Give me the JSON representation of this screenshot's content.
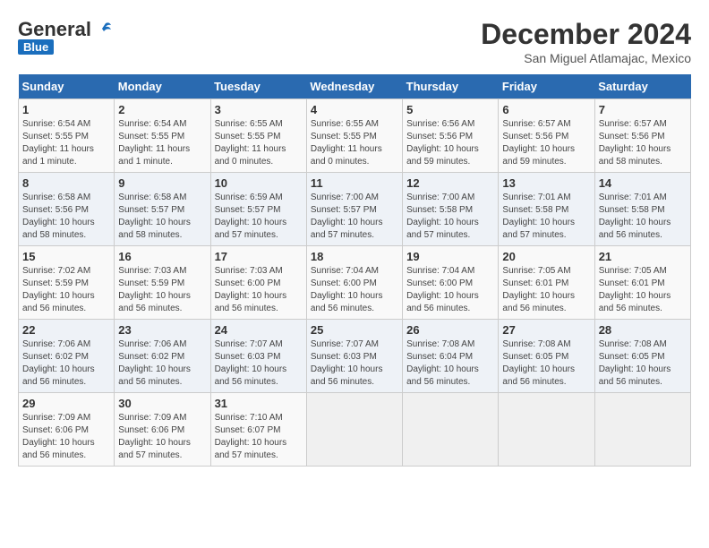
{
  "logo": {
    "general": "General",
    "blue": "Blue"
  },
  "title": "December 2024",
  "subtitle": "San Miguel Atlamajac, Mexico",
  "days_header": [
    "Sunday",
    "Monday",
    "Tuesday",
    "Wednesday",
    "Thursday",
    "Friday",
    "Saturday"
  ],
  "weeks": [
    [
      {
        "day": "1",
        "info": "Sunrise: 6:54 AM\nSunset: 5:55 PM\nDaylight: 11 hours and 1 minute."
      },
      {
        "day": "2",
        "info": "Sunrise: 6:54 AM\nSunset: 5:55 PM\nDaylight: 11 hours and 1 minute."
      },
      {
        "day": "3",
        "info": "Sunrise: 6:55 AM\nSunset: 5:55 PM\nDaylight: 11 hours and 0 minutes."
      },
      {
        "day": "4",
        "info": "Sunrise: 6:55 AM\nSunset: 5:55 PM\nDaylight: 11 hours and 0 minutes."
      },
      {
        "day": "5",
        "info": "Sunrise: 6:56 AM\nSunset: 5:56 PM\nDaylight: 10 hours and 59 minutes."
      },
      {
        "day": "6",
        "info": "Sunrise: 6:57 AM\nSunset: 5:56 PM\nDaylight: 10 hours and 59 minutes."
      },
      {
        "day": "7",
        "info": "Sunrise: 6:57 AM\nSunset: 5:56 PM\nDaylight: 10 hours and 58 minutes."
      }
    ],
    [
      {
        "day": "8",
        "info": "Sunrise: 6:58 AM\nSunset: 5:56 PM\nDaylight: 10 hours and 58 minutes."
      },
      {
        "day": "9",
        "info": "Sunrise: 6:58 AM\nSunset: 5:57 PM\nDaylight: 10 hours and 58 minutes."
      },
      {
        "day": "10",
        "info": "Sunrise: 6:59 AM\nSunset: 5:57 PM\nDaylight: 10 hours and 57 minutes."
      },
      {
        "day": "11",
        "info": "Sunrise: 7:00 AM\nSunset: 5:57 PM\nDaylight: 10 hours and 57 minutes."
      },
      {
        "day": "12",
        "info": "Sunrise: 7:00 AM\nSunset: 5:58 PM\nDaylight: 10 hours and 57 minutes."
      },
      {
        "day": "13",
        "info": "Sunrise: 7:01 AM\nSunset: 5:58 PM\nDaylight: 10 hours and 57 minutes."
      },
      {
        "day": "14",
        "info": "Sunrise: 7:01 AM\nSunset: 5:58 PM\nDaylight: 10 hours and 56 minutes."
      }
    ],
    [
      {
        "day": "15",
        "info": "Sunrise: 7:02 AM\nSunset: 5:59 PM\nDaylight: 10 hours and 56 minutes."
      },
      {
        "day": "16",
        "info": "Sunrise: 7:03 AM\nSunset: 5:59 PM\nDaylight: 10 hours and 56 minutes."
      },
      {
        "day": "17",
        "info": "Sunrise: 7:03 AM\nSunset: 6:00 PM\nDaylight: 10 hours and 56 minutes."
      },
      {
        "day": "18",
        "info": "Sunrise: 7:04 AM\nSunset: 6:00 PM\nDaylight: 10 hours and 56 minutes."
      },
      {
        "day": "19",
        "info": "Sunrise: 7:04 AM\nSunset: 6:00 PM\nDaylight: 10 hours and 56 minutes."
      },
      {
        "day": "20",
        "info": "Sunrise: 7:05 AM\nSunset: 6:01 PM\nDaylight: 10 hours and 56 minutes."
      },
      {
        "day": "21",
        "info": "Sunrise: 7:05 AM\nSunset: 6:01 PM\nDaylight: 10 hours and 56 minutes."
      }
    ],
    [
      {
        "day": "22",
        "info": "Sunrise: 7:06 AM\nSunset: 6:02 PM\nDaylight: 10 hours and 56 minutes."
      },
      {
        "day": "23",
        "info": "Sunrise: 7:06 AM\nSunset: 6:02 PM\nDaylight: 10 hours and 56 minutes."
      },
      {
        "day": "24",
        "info": "Sunrise: 7:07 AM\nSunset: 6:03 PM\nDaylight: 10 hours and 56 minutes."
      },
      {
        "day": "25",
        "info": "Sunrise: 7:07 AM\nSunset: 6:03 PM\nDaylight: 10 hours and 56 minutes."
      },
      {
        "day": "26",
        "info": "Sunrise: 7:08 AM\nSunset: 6:04 PM\nDaylight: 10 hours and 56 minutes."
      },
      {
        "day": "27",
        "info": "Sunrise: 7:08 AM\nSunset: 6:05 PM\nDaylight: 10 hours and 56 minutes."
      },
      {
        "day": "28",
        "info": "Sunrise: 7:08 AM\nSunset: 6:05 PM\nDaylight: 10 hours and 56 minutes."
      }
    ],
    [
      {
        "day": "29",
        "info": "Sunrise: 7:09 AM\nSunset: 6:06 PM\nDaylight: 10 hours and 56 minutes."
      },
      {
        "day": "30",
        "info": "Sunrise: 7:09 AM\nSunset: 6:06 PM\nDaylight: 10 hours and 57 minutes."
      },
      {
        "day": "31",
        "info": "Sunrise: 7:10 AM\nSunset: 6:07 PM\nDaylight: 10 hours and 57 minutes."
      },
      {
        "day": "",
        "info": ""
      },
      {
        "day": "",
        "info": ""
      },
      {
        "day": "",
        "info": ""
      },
      {
        "day": "",
        "info": ""
      }
    ]
  ]
}
